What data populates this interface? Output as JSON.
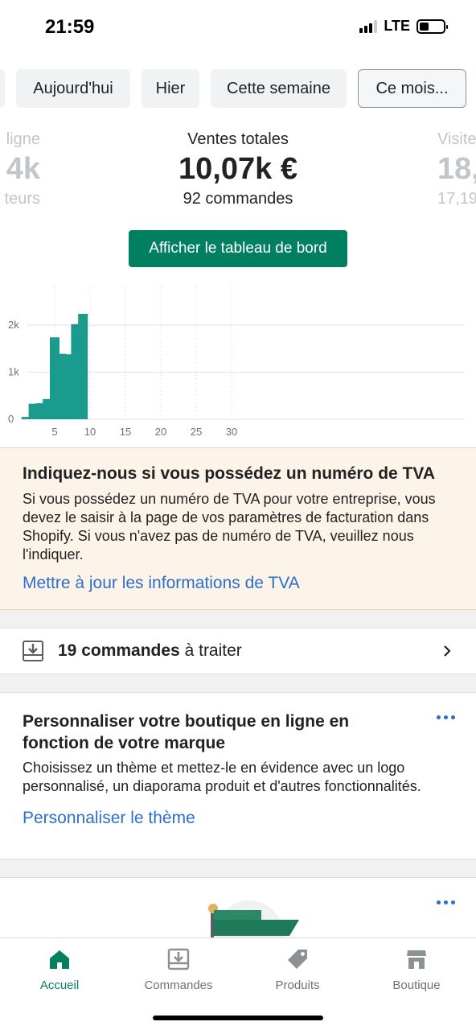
{
  "status_bar": {
    "time": "21:59",
    "network": "LTE",
    "battery_level": 0.4
  },
  "date_filters": [
    {
      "label": "Aujourd'hui",
      "selected": false
    },
    {
      "label": "Hier",
      "selected": false
    },
    {
      "label": "Cette semaine",
      "selected": false
    },
    {
      "label": "Ce mois...",
      "selected": true
    }
  ],
  "metrics": {
    "left": {
      "label": "ligne",
      "value": "4k",
      "sub": "teurs"
    },
    "center": {
      "label": "Ventes totales",
      "value": "10,07k €",
      "sub": "92 commandes"
    },
    "right": {
      "label": "Visite",
      "value": "18,",
      "sub": "17,19"
    }
  },
  "dashboard_button": "Afficher le tableau de bord",
  "chart_data": {
    "type": "bar",
    "x": [
      1,
      2,
      3,
      4,
      5,
      6,
      7,
      8,
      9
    ],
    "values": [
      50,
      330,
      340,
      430,
      1740,
      1390,
      1380,
      2020,
      2240
    ],
    "xlim": [
      0,
      31
    ],
    "ylim": [
      0,
      2800
    ],
    "y_ticks": [
      "0",
      "1k",
      "2k"
    ],
    "x_ticks": [
      "5",
      "10",
      "15",
      "20",
      "25",
      "30"
    ],
    "color": "#1b9a8e",
    "grid": true
  },
  "tva_banner": {
    "title": "Indiquez-nous si vous possédez un numéro de TVA",
    "body": "Si vous possédez un numéro de TVA pour votre entreprise, vous devez le saisir à la page de vos paramètres de facturation dans Shopify. Si vous n'avez pas de numéro de TVA, veuillez nous l'indiquer.",
    "link": "Mettre à jour les informations de TVA"
  },
  "orders_row": {
    "count": "19 commandes",
    "suffix": "à traiter"
  },
  "theme_card": {
    "title": "Personnaliser votre boutique en ligne en fonction de votre marque",
    "body": "Choisissez un thème et mettez-le en évidence avec un logo personnalisé, un diaporama produit et d'autres fonctionnalités.",
    "link": "Personnaliser le thème"
  },
  "tabs": [
    {
      "label": "Accueil",
      "icon": "home-icon",
      "active": true
    },
    {
      "label": "Commandes",
      "icon": "orders-icon",
      "active": false
    },
    {
      "label": "Produits",
      "icon": "tag-icon",
      "active": false
    },
    {
      "label": "Boutique",
      "icon": "store-icon",
      "active": false
    }
  ],
  "colors": {
    "primary": "#008060",
    "link": "#2c6ecb",
    "banner_bg": "#fdf4e9"
  }
}
